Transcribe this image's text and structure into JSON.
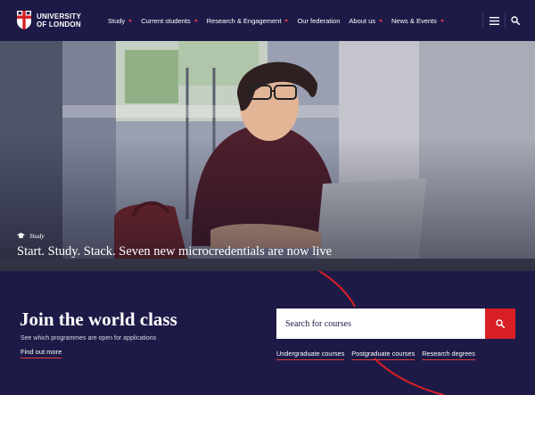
{
  "header": {
    "logo_line1": "UNIVERSITY",
    "logo_line2": "OF LONDON",
    "nav": [
      {
        "label": "Study",
        "dropdown": true
      },
      {
        "label": "Current students",
        "dropdown": true
      },
      {
        "label": "Research & Engagement",
        "dropdown": true
      },
      {
        "label": "Our federation",
        "dropdown": false
      },
      {
        "label": "About us",
        "dropdown": true
      },
      {
        "label": "News & Events",
        "dropdown": true
      }
    ],
    "menu_icon": "hamburger-menu-icon",
    "search_icon": "search-icon"
  },
  "hero": {
    "category": "Study",
    "category_icon": "graduation-cap-icon",
    "title": "Start. Study. Stack. Seven new microcredentials are now live",
    "image_description_icon": "photo"
  },
  "join": {
    "title": "Join the world class",
    "subtitle": "See which programmes are open for applications",
    "link": "Find out more"
  },
  "search": {
    "placeholder": "Search for courses",
    "button_icon": "search-icon"
  },
  "course_links": [
    "Undergraduate courses",
    "Postgraduate courses",
    "Research degrees"
  ],
  "colors": {
    "navy": "#1e1a47",
    "accent_red": "#d81f26",
    "underline_red": "#e23c3c",
    "white": "#ffffff"
  }
}
